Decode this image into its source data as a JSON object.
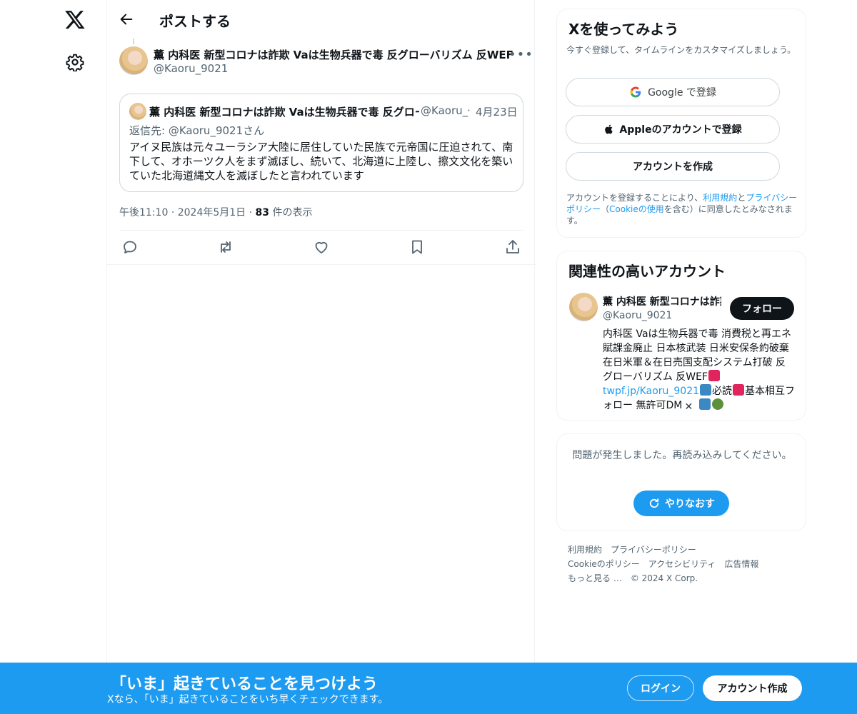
{
  "nav": {
    "logo_icon": "x-logo-icon",
    "settings_icon": "gear-icon"
  },
  "header": {
    "title": "ポストする",
    "back_icon": "arrow-left-icon"
  },
  "post": {
    "author_name": "薫 内科医 新型コロナは詐欺 Vaは生物兵器で毒 反グローバリズム 反WEF",
    "author_handle": "@Kaoru_9021",
    "more_label": "•••",
    "quoted": {
      "author_name": "薫 内科医 新型コロナは詐欺 Vaは生物兵器で毒 反グローバリズム 反WEF",
      "author_handle": "@Kaoru_",
      "separator": "·",
      "date": "4月23日",
      "reply_to": "返信先: @Kaoru_9021さん",
      "text": "アイヌ民族は元々ユーラシア大陸に居住していた民族で元帝国に圧迫されて、南下して、オホーツク人をまず滅ぼし、続いて、北海道に上陸し、擦文文化を築いていた北海道縄文人を滅ぼしたと言われています"
    },
    "time": "午後11:10",
    "date": "2024年5月1日",
    "views_count": "83",
    "views_label": "件の表示",
    "dot": "·",
    "actions": [
      "reply-icon",
      "repost-icon",
      "like-icon",
      "bookmark-icon",
      "share-icon"
    ]
  },
  "signup_card": {
    "title": "Xを使ってみよう",
    "subtitle": "今すぐ登録して、タイムラインをカスタマイズしましょう。",
    "google_label": "Google で登録",
    "apple_label": "Appleのアカウントで登録",
    "create_label": "アカウントを作成",
    "terms_prefix": "アカウントを登録することにより、",
    "terms_link1": "利用規約",
    "terms_and": "と",
    "terms_link2": "プライバシーポリシー",
    "terms_mid": "（",
    "terms_link3": "Cookieの使用",
    "terms_suffix": "を含む）に同意したとみなされます。"
  },
  "related_card": {
    "title": "関連性の高いアカウント",
    "name": "薫 内科医 新型コロナは詐欺 Vaは生物兵器で毒",
    "handle": "@Kaoru_9021",
    "follow_label": "フォロー",
    "bio_part1": "内科医 Vaは生物兵器で毒 消費税と再エネ賦課金廃止 日本核武装 日米安保条約破棄 在日米軍＆在日売国支配システム打破 反グローバリズム 反WEF",
    "bio_link": "twpf.jp/Kaoru_9021",
    "bio_part2": "必読",
    "bio_part3": "基本相互フォロー 無許可DM"
  },
  "error_card": {
    "message": "問題が発生しました。再読み込みしてください。",
    "retry_label": "やりなおす"
  },
  "footer": {
    "links": [
      "利用規約",
      "プライバシーポリシー",
      "Cookieのポリシー",
      "アクセシビリティ",
      "広告情報",
      "もっと見る …",
      "© 2024 X Corp."
    ]
  },
  "banner": {
    "title": "「いま」起きていることを見つけよう",
    "subtitle": "Xなら、「いま」起きていることをいち早くチェックできます。",
    "login_label": "ログイン",
    "signup_label": "アカウント作成"
  },
  "colors": {
    "accent": "#1d9bf0",
    "text": "#0f1419",
    "muted": "#536471",
    "border": "#eff3f4"
  }
}
